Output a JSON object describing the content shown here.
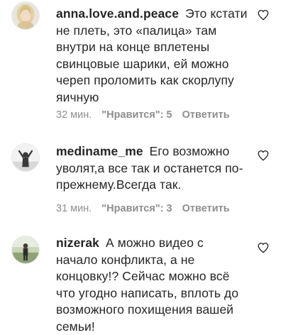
{
  "comments": [
    {
      "username": "anna.love.and.peace",
      "text": "Это кстати не плеть, это «палица» там внутри на конце вплетены свинцовые шарики, ей можно череп проломить как скорлупу яичную",
      "time": "32 мин.",
      "likes": "\"Нравится\": 5",
      "reply": "Ответить",
      "avatar_icon": "avatar-blonde-woman-icon",
      "like_icon": "heart-outline-icon"
    },
    {
      "username": "mediname_me",
      "text": "Его возможно уволят,а все так и останется по-прежнему.Всегда так.",
      "time": "31 мин.",
      "likes": "\"Нравится\": 3",
      "reply": "Ответить",
      "avatar_icon": "avatar-silhouette-icon",
      "like_icon": "heart-outline-icon"
    },
    {
      "username": "nizerak",
      "text": "А можно видео с начало конфликта, а не концовку!? Сейчас можно всё что угодно написать, вплоть до возможного похищения вашей семьи!",
      "avatar_icon": "avatar-outdoor-person-icon",
      "like_icon": "heart-outline-icon"
    }
  ],
  "colors": {
    "text": "#262626",
    "secondary": "#8e8e8e",
    "background": "#ffffff"
  }
}
